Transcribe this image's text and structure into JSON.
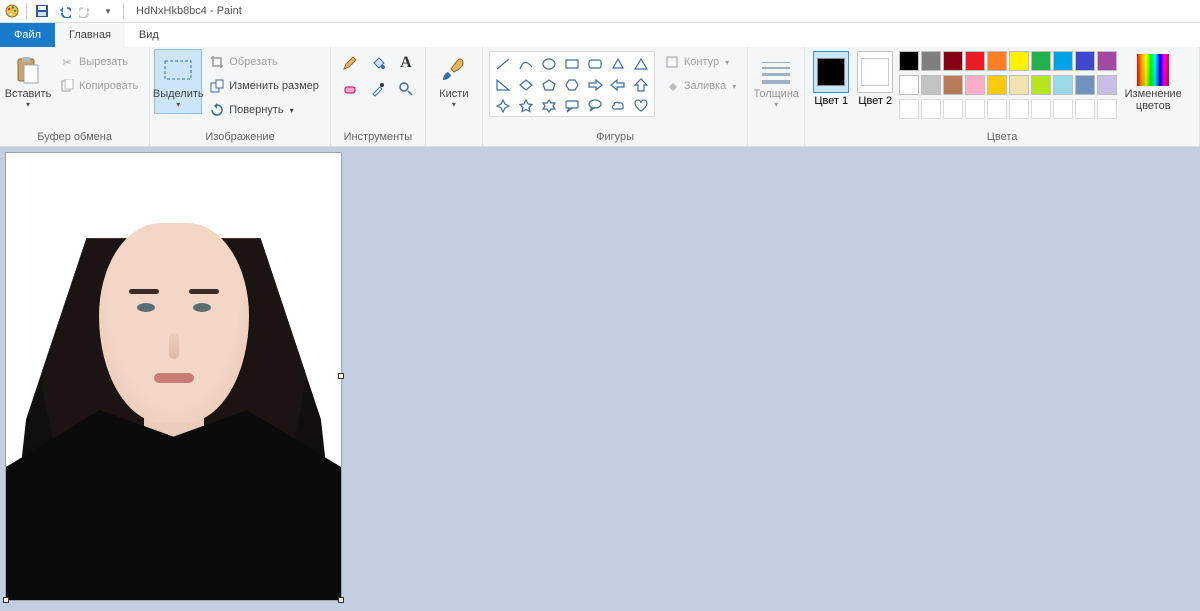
{
  "title": {
    "document": "HdNxHkb8bc4",
    "app": "Paint"
  },
  "tabs": {
    "file": "Файл",
    "home": "Главная",
    "view": "Вид"
  },
  "clipboard": {
    "paste": "Вставить",
    "cut": "Вырезать",
    "copy": "Копировать",
    "group": "Буфер обмена"
  },
  "image": {
    "select": "Выделить",
    "crop": "Обрезать",
    "resize": "Изменить размер",
    "rotate": "Повернуть",
    "group": "Изображение"
  },
  "tools": {
    "group": "Инструменты"
  },
  "brushes": {
    "label": "Кисти"
  },
  "shapes": {
    "outline": "Контур",
    "fill": "Заливка",
    "group": "Фигуры"
  },
  "size": {
    "label": "Толщина"
  },
  "colors": {
    "color1": "Цвет 1",
    "color2": "Цвет 2",
    "edit": "Изменение цветов",
    "group": "Цвета",
    "palette_row1": [
      "#000000",
      "#7f7f7f",
      "#880015",
      "#ed1c24",
      "#ff7f27",
      "#fff200",
      "#22b14c",
      "#00a2e8",
      "#3f48cc",
      "#a349a4"
    ],
    "palette_row2": [
      "#ffffff",
      "#c3c3c3",
      "#b97a57",
      "#ffaec9",
      "#ffc90e",
      "#efe4b0",
      "#b5e61d",
      "#99d9ea",
      "#7092be",
      "#c8bfe7"
    ],
    "color1_value": "#000000",
    "color2_value": "#ffffff"
  }
}
